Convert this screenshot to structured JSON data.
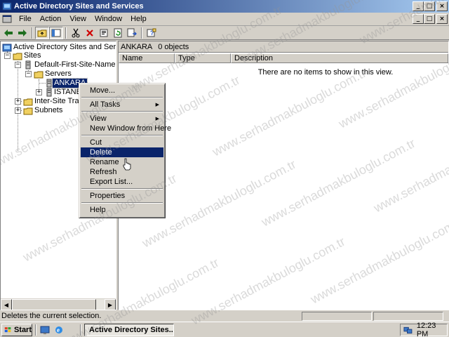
{
  "window": {
    "title": "Active Directory Sites and Services",
    "controls": {
      "minimize": "_",
      "maximize": "□",
      "close": "×"
    }
  },
  "menubar": {
    "items": [
      "File",
      "Action",
      "View",
      "Window",
      "Help"
    ]
  },
  "toolbar": {
    "icons": [
      "back-arrow-icon",
      "forward-arrow-icon",
      "up-folder-icon",
      "show-hide-tree-icon",
      "cut-icon",
      "delete-icon",
      "properties-icon",
      "refresh-icon",
      "export-list-icon",
      "help-icon"
    ]
  },
  "tree": {
    "root": "Active Directory Sites and Services [is",
    "sites": "Sites",
    "default_site": "Default-First-Site-Name",
    "servers": "Servers",
    "ankara": "ANKARA",
    "istanbul": "ISTANBU",
    "inter_site": "Inter-Site Transp",
    "subnets": "Subnets"
  },
  "right_pane": {
    "path_title": "ANKARA",
    "object_count": "0 objects",
    "columns": [
      "Name",
      "Type",
      "Description"
    ],
    "empty_message": "There are no items to show in this view."
  },
  "context_menu": {
    "move": "Move...",
    "all_tasks": "All Tasks",
    "view": "View",
    "new_window": "New Window from Here",
    "cut": "Cut",
    "delete": "Delete",
    "rename": "Rename",
    "refresh": "Refresh",
    "export_list": "Export List...",
    "properties": "Properties",
    "help": "Help"
  },
  "statusbar": {
    "text": "Deletes the current selection."
  },
  "taskbar": {
    "start": "Start",
    "task_button": "Active Directory Sites...",
    "clock": "12:23 PM"
  },
  "watermark": "www.serhadmakbuloglu.com.tr",
  "colors": {
    "title_start": "#0a246a",
    "title_end": "#a6caf0",
    "selection": "#0a246a",
    "face": "#d4d0c8"
  }
}
